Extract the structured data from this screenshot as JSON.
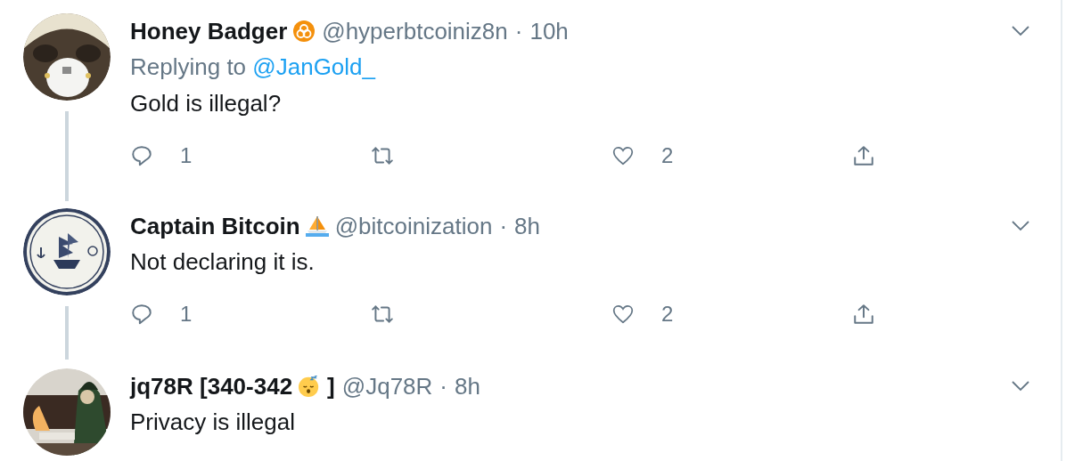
{
  "tweets": [
    {
      "name": "Honey Badger",
      "badge": {
        "kind": "biohazard"
      },
      "handle": "@hyperbtcoiniz8n",
      "separator": "·",
      "time": "10h",
      "reply_label": "Replying to",
      "reply_to": "@JanGold_",
      "text": "Gold is illegal?",
      "thread_line": true,
      "actions": [
        {
          "kind": "reply",
          "count": "1"
        },
        {
          "kind": "retweet"
        },
        {
          "kind": "like",
          "count": "2"
        },
        {
          "kind": "share"
        }
      ]
    },
    {
      "name": "Captain Bitcoin",
      "badge": {
        "kind": "sailboat"
      },
      "handle": "@bitcoinization",
      "separator": "·",
      "time": "8h",
      "text": "Not declaring it is.",
      "thread_line": true,
      "actions": [
        {
          "kind": "reply",
          "count": "1"
        },
        {
          "kind": "retweet"
        },
        {
          "kind": "like",
          "count": "2"
        },
        {
          "kind": "share"
        }
      ]
    },
    {
      "name": "jq78R [340-342",
      "badge": {
        "kind": "sleeping"
      },
      "name_suffix": "]",
      "handle": "@Jq78R",
      "separator": "·",
      "time": "8h",
      "text": "Privacy is illegal",
      "thread_line": false
    }
  ]
}
